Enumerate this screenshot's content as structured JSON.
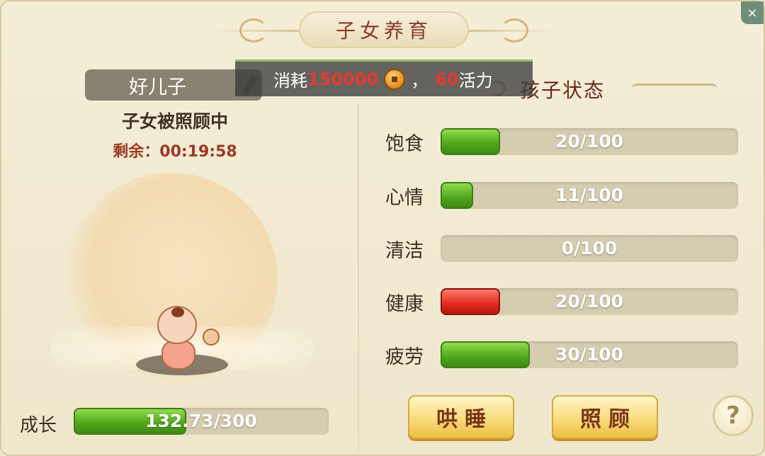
{
  "title": "子女养育",
  "close_label": "×",
  "cost": {
    "prefix": "消耗",
    "amount": "150000",
    "separator": "，",
    "vitality": "60",
    "suffix": "活力"
  },
  "child": {
    "name": "好儿子",
    "care_status": "子女被照顾中",
    "remaining_label": "剩余：",
    "remaining_time": "00:19:58"
  },
  "growth": {
    "label": "成长",
    "text": "132.73/300",
    "fraction": 0.4424
  },
  "status_title": "孩子状态",
  "stats": [
    {
      "label": "饱食",
      "text": "20/100",
      "fraction": 0.2,
      "color": "green"
    },
    {
      "label": "心情",
      "text": "11/100",
      "fraction": 0.11,
      "color": "green"
    },
    {
      "label": "清洁",
      "text": "0/100",
      "fraction": 0.0,
      "color": "green"
    },
    {
      "label": "健康",
      "text": "20/100",
      "fraction": 0.2,
      "color": "red"
    },
    {
      "label": "疲劳",
      "text": "30/100",
      "fraction": 0.3,
      "color": "green"
    }
  ],
  "buttons": {
    "sleep": "哄睡",
    "care": "照顾",
    "help": "?"
  }
}
